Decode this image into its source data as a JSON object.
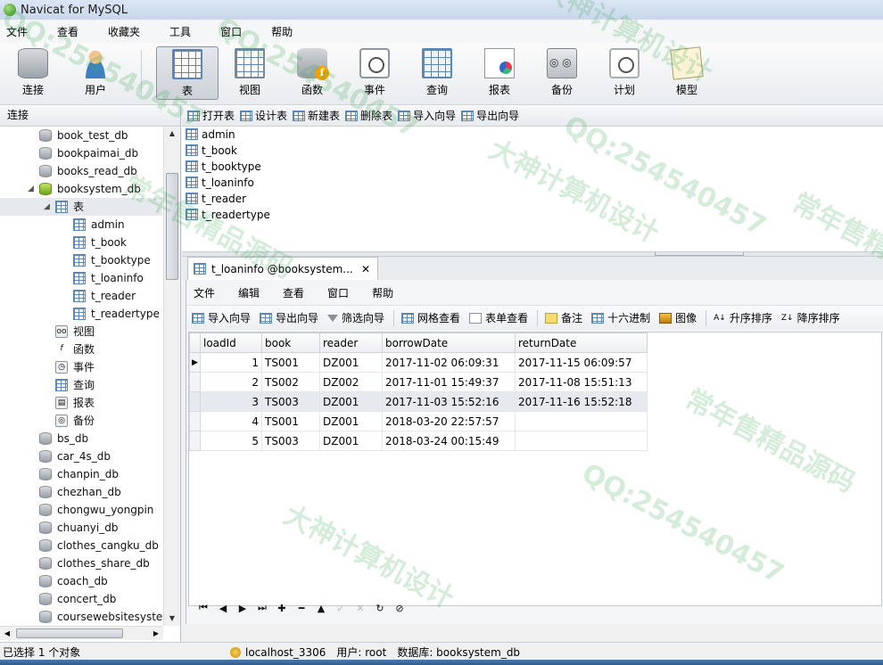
{
  "window": {
    "title": "Navicat for MySQL"
  },
  "menu": [
    "文件",
    "查看",
    "收藏夹",
    "工具",
    "窗口",
    "帮助"
  ],
  "toolbar": {
    "connect": "连接",
    "user": "用户",
    "table": "表",
    "view": "视图",
    "function": "函数",
    "event": "事件",
    "query": "查询",
    "report": "报表",
    "backup": "备份",
    "schedule": "计划",
    "model": "模型"
  },
  "left_pane": {
    "header": "连接",
    "items": [
      "book_test_db",
      "bookpaimai_db",
      "books_read_db",
      "booksystem_db",
      "表",
      "admin",
      "t_book",
      "t_booktype",
      "t_loaninfo",
      "t_reader",
      "t_readertype",
      "视图",
      "函数",
      "事件",
      "查询",
      "报表",
      "备份",
      "bs_db",
      "car_4s_db",
      "chanpin_db",
      "chezhan_db",
      "chongwu_yongpin",
      "chuanyi_db",
      "clothes_cangku_db",
      "clothes_share_db",
      "coach_db",
      "concert_db",
      "coursewebsitesyster"
    ],
    "scroll_up": "▲",
    "scroll_down": "▼",
    "scroll_left": "◀",
    "scroll_right": "▶",
    "expand_icon": "◢"
  },
  "object_toolbar": {
    "open": "打开表",
    "design": "设计表",
    "new": "新建表",
    "delete": "删除表",
    "import": "导入向导",
    "export": "导出向导"
  },
  "objects": [
    "admin",
    "t_book",
    "t_booktype",
    "t_loaninfo",
    "t_reader",
    "t_readertype"
  ],
  "tab": {
    "label": "t_loaninfo @booksystem...",
    "close": "✕"
  },
  "doc_menu": [
    "文件",
    "编辑",
    "查看",
    "窗口",
    "帮助"
  ],
  "doc_toolbar": {
    "import": "导入向导",
    "export": "导出向导",
    "filter": "筛选向导",
    "grid_view": "网格查看",
    "form_view": "表单查看",
    "memo": "备注",
    "hex": "十六进制",
    "image": "图像",
    "sort_asc": "升序排序",
    "sort_desc": "降序排序"
  },
  "grid": {
    "columns": [
      "loadId",
      "book",
      "reader",
      "borrowDate",
      "returnDate"
    ],
    "current_row_marker": "▶",
    "rows": [
      [
        "1",
        "TS001",
        "DZ001",
        "2017-11-02 06:09:31",
        "2017-11-15 06:09:57"
      ],
      [
        "2",
        "TS002",
        "DZ002",
        "2017-11-01 15:49:37",
        "2017-11-08 15:51:13"
      ],
      [
        "3",
        "TS003",
        "DZ001",
        "2017-11-03 15:52:16",
        "2017-11-16 15:52:18"
      ],
      [
        "4",
        "TS001",
        "DZ001",
        "2018-03-20 22:57:57",
        ""
      ],
      [
        "5",
        "TS003",
        "DZ001",
        "2018-03-24 00:15:49",
        ""
      ]
    ]
  },
  "nav": {
    "first": "⏮",
    "prev": "◀",
    "next": "▶",
    "last": "⏭",
    "add": "✚",
    "remove": "━",
    "up": "▲",
    "check": "✓",
    "cancel": "✕",
    "refresh": "↻",
    "stop": "⊘"
  },
  "status": {
    "selected": "已选择 1 个对象",
    "connection": "localhost_3306",
    "user": "用户: root",
    "database": "数据库: booksystem_db"
  },
  "watermarks": [
    "QQ:254540457",
    "大神计算机设计",
    "常年售精品源码",
    "QQ:254540457",
    "大神计算机设计",
    "常年售精品源码",
    "QQ:254540457",
    "大神计算机设计",
    "常年售精品源码",
    "QQ:254540457"
  ]
}
